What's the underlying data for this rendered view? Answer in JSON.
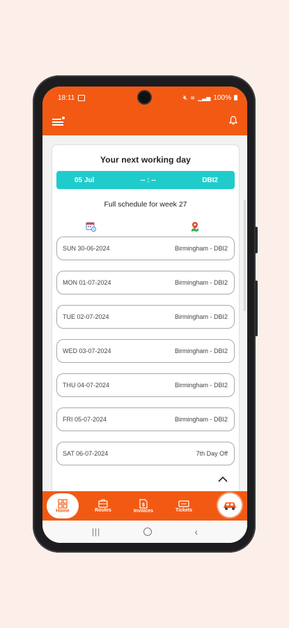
{
  "status": {
    "time": "18:11",
    "battery": "100%"
  },
  "header": {
    "next_title": "Your next working day",
    "next_date": "05 Jul",
    "next_time": "-- : --",
    "next_code": "DBI2",
    "schedule_title": "Full schedule for week 27"
  },
  "schedule": [
    {
      "day": "SUN 30-06-2024",
      "location": "Birmingham - DBI2"
    },
    {
      "day": "MON 01-07-2024",
      "location": "Birmingham - DBI2"
    },
    {
      "day": "TUE 02-07-2024",
      "location": "Birmingham - DBI2"
    },
    {
      "day": "WED 03-07-2024",
      "location": "Birmingham - DBI2"
    },
    {
      "day": "THU 04-07-2024",
      "location": "Birmingham - DBI2"
    },
    {
      "day": "FRI 05-07-2024",
      "location": "Birmingham - DBI2"
    },
    {
      "day": "SAT 06-07-2024",
      "location": "7th Day Off"
    }
  ],
  "nav": {
    "home": "Home",
    "routes": "Routes",
    "invoices": "Invoices",
    "tickets": "Tickets"
  },
  "colors": {
    "brand": "#f25a14",
    "accent": "#20cccb"
  },
  "icons": {
    "menu": "hamburger-icon",
    "notifications": "bell-icon",
    "calendar": "calendar-icon",
    "location": "map-pin-icon",
    "collapse": "chevron-up-icon",
    "fab": "car-icon"
  }
}
